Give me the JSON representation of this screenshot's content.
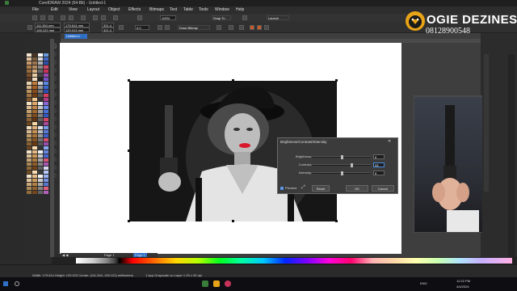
{
  "window": {
    "title": "CorelDRAW 2024 (64-Bit) - Untitled-1"
  },
  "menu": [
    "File",
    "Edit",
    "View",
    "Layout",
    "Object",
    "Effects",
    "Bitmaps",
    "Text",
    "Table",
    "Tools",
    "Window",
    "Help"
  ],
  "standard_bar": {
    "zoom": "100%",
    "snap_label": "Snap To",
    "launch_label": "Launch"
  },
  "property_bar": {
    "x": "111.264 mm",
    "y": "105.122 mm",
    "w": "179.614 mm",
    "h": "120.013 mm",
    "sx": "321.4",
    "sy": "321.4",
    "angle": "0.0",
    "wrap": "Draw Bitmap"
  },
  "document": {
    "tab": "Untitled-1"
  },
  "dialog": {
    "title": "Brightness/Contrast/Intensity",
    "rows": [
      {
        "label": "Brightness:",
        "value": "0",
        "level": 0.5
      },
      {
        "label": "Contrast:",
        "value": "33",
        "level": 0.68
      },
      {
        "label": "Intensity:",
        "value": "0",
        "level": 0.5
      }
    ],
    "preview_label": "Preview",
    "reset_label": "Reset",
    "ok_label": "OK",
    "cancel_label": "Cancel"
  },
  "page_nav": {
    "page1": "Page 1",
    "page2": "Page 1"
  },
  "status": {
    "dimensions": "Width: 179.614 Height: 120.013  Center: (111.264, 105.122) millimeters",
    "object": "1 bpp Grayscale on Layer 1 93 x 93 dpi"
  },
  "taskbar": {
    "time": "12:22 PM",
    "date": "4/4/2024",
    "lang": "ENG"
  },
  "logo": {
    "name": "OGIE DEZINES",
    "phone": "08128900548"
  },
  "colors": {
    "accent": "#2f6fc6",
    "lips": "#d8192b",
    "logo_gold": "#e8a317"
  }
}
